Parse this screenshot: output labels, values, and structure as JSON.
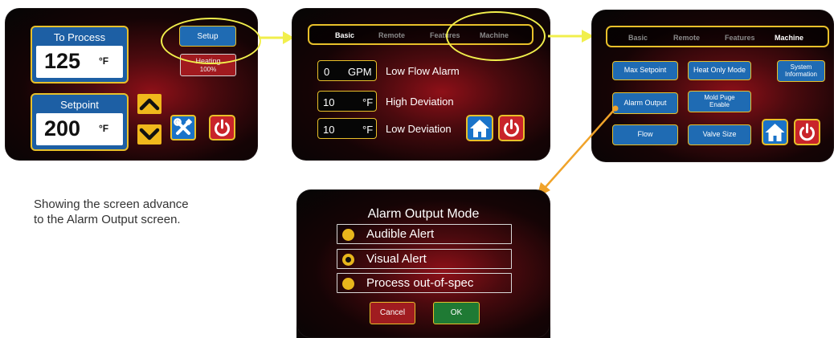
{
  "screen1": {
    "to_process_label": "To Process",
    "to_process_value": "125",
    "to_process_unit": "°F",
    "setup_label": "Setup",
    "heating_label": "Heating",
    "heating_value": "100%",
    "setpoint_label": "Setpoint",
    "setpoint_value": "200",
    "setpoint_unit": "°F"
  },
  "screen2": {
    "tabs": [
      "Basic",
      "Remote",
      "Features",
      "Machine"
    ],
    "active_tab": "Basic",
    "rows": [
      {
        "value": "0",
        "unit": "GPM",
        "label": "Low Flow Alarm"
      },
      {
        "value": "10",
        "unit": "°F",
        "label": "High Deviation"
      },
      {
        "value": "10",
        "unit": "°F",
        "label": "Low Deviation"
      }
    ]
  },
  "screen3": {
    "tabs": [
      "Basic",
      "Remote",
      "Features",
      "Machine"
    ],
    "active_tab": "Machine",
    "buttons": {
      "max_setpoint": "Max Setpoint",
      "heat_only_mode": "Heat Only Mode",
      "system_information": "System Information",
      "alarm_output": "Alarm Output",
      "mold_purge_enable": "Mold Puge Enable",
      "flow": "Flow",
      "valve_size": "Valve Size"
    }
  },
  "screen4": {
    "title": "Alarm Output Mode",
    "options": [
      {
        "label": "Audible Alert",
        "selected": false
      },
      {
        "label": "Visual Alert",
        "selected": true
      },
      {
        "label": "Process out-of-spec",
        "selected": false
      }
    ],
    "cancel_label": "Cancel",
    "ok_label": "OK"
  },
  "caption": "Showing the screen advance to the Alarm Output screen.",
  "colors": {
    "accent_yellow": "#e8c02a",
    "highlight_yellow": "#f1ef4c",
    "button_blue": "#1f6bb3",
    "power_red": "#c9242a",
    "ok_green": "#1f7a34",
    "cancel_red": "#a01c20",
    "callout_orange": "#f0a32a"
  },
  "icons": [
    "up-arrow-icon",
    "down-arrow-icon",
    "tools-icon",
    "power-icon",
    "home-icon"
  ]
}
